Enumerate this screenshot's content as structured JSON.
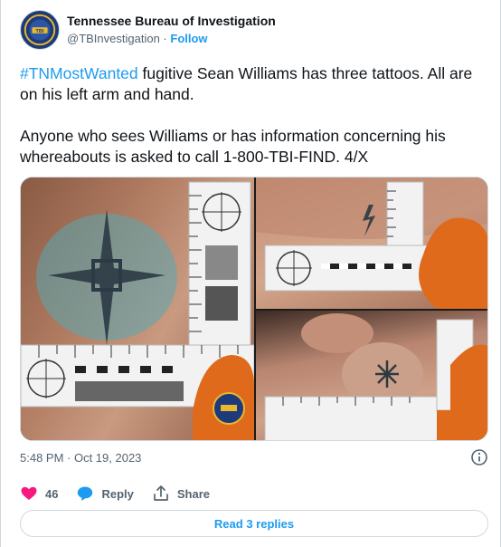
{
  "author": {
    "display_name": "Tennessee Bureau of Investigation",
    "handle": "@TBInvestigation",
    "separator": " · ",
    "follow_label": "Follow",
    "avatar_icon": "tbi-seal-icon"
  },
  "tweet": {
    "hashtag": "#TNMostWanted",
    "text_after_hashtag": " fugitive Sean Williams has three tattoos. All are on his left arm and hand.",
    "paragraph2": "Anyone who sees Williams or has information concerning his whereabouts is asked to call 1-800-TBI-FIND. 4/X"
  },
  "media": {
    "photos": [
      {
        "name": "cross-tattoo-photo",
        "icon": "forearm-cross-tattoo"
      },
      {
        "name": "lightning-tattoo-photo",
        "icon": "arm-lightning-bolt-tattoo"
      },
      {
        "name": "star-tattoo-photo",
        "icon": "finger-star-tattoo"
      }
    ]
  },
  "meta": {
    "timestamp": "5:48 PM · Oct 19, 2023"
  },
  "actions": {
    "like_count": "46",
    "reply_label": "Reply",
    "share_label": "Share"
  },
  "footer": {
    "read_replies_label": "Read 3 replies"
  },
  "colors": {
    "accent": "#1d9bf0",
    "like": "#f91880",
    "muted": "#536471",
    "border": "#cfd9de"
  }
}
